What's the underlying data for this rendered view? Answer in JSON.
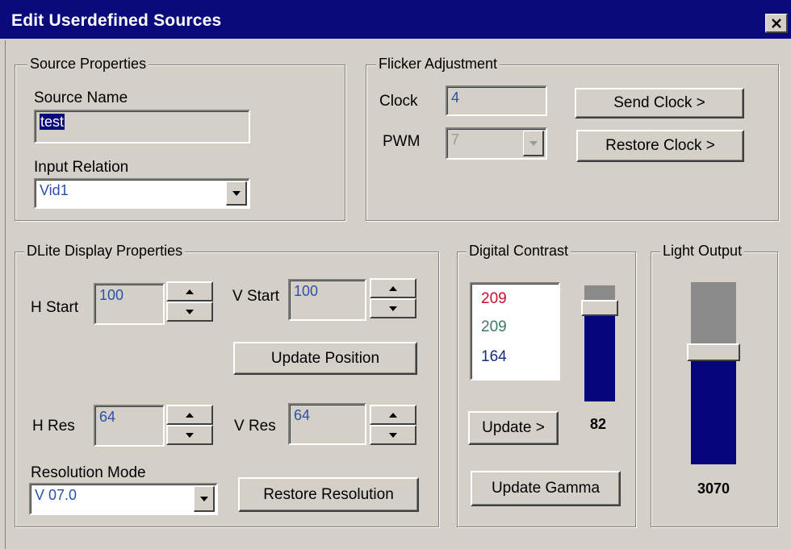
{
  "window": {
    "title": "Edit Userdefined Sources"
  },
  "source_properties": {
    "group_label": "Source Properties",
    "name_label": "Source Name",
    "name_value": "test",
    "input_relation_label": "Input Relation",
    "input_relation_value": "Vid1"
  },
  "flicker": {
    "group_label": "Flicker Adjustment",
    "clock_label": "Clock",
    "clock_value": "4",
    "pwm_label": "PWM",
    "pwm_value": "7",
    "send_clock_label": "Send Clock >",
    "restore_clock_label": "Restore Clock >"
  },
  "display_properties": {
    "group_label": "DLite Display Properties",
    "h_start_label": "H Start",
    "h_start_value": "100",
    "v_start_label": "V Start",
    "v_start_value": "100",
    "update_position_label": "Update Position",
    "h_res_label": "H Res",
    "h_res_value": "64",
    "v_res_label": "V Res",
    "v_res_value": "64",
    "resolution_mode_label": "Resolution Mode",
    "resolution_mode_value": "V 07.0",
    "restore_resolution_label": "Restore Resolution"
  },
  "digital_contrast": {
    "group_label": "Digital Contrast",
    "values": [
      {
        "text": "209",
        "color": "#c8102e"
      },
      {
        "text": "209",
        "color": "#3a7a6a"
      },
      {
        "text": "164",
        "color": "#1a2a7a"
      }
    ],
    "slider_value": "82",
    "update_label": "Update >",
    "update_gamma_label": "Update Gamma"
  },
  "light_output": {
    "group_label": "Light Output",
    "slider_value": "3070"
  },
  "icons": {
    "close": "close-icon",
    "combo_arrow": "triangle-down-icon",
    "spin_up": "triangle-up-icon",
    "spin_down": "triangle-down-icon"
  },
  "colors": {
    "title_bar": "#0a0a7a",
    "dialog_face": "#d4d0c8",
    "slider_fill": "#06067a",
    "field_text": "#2a50a8"
  }
}
